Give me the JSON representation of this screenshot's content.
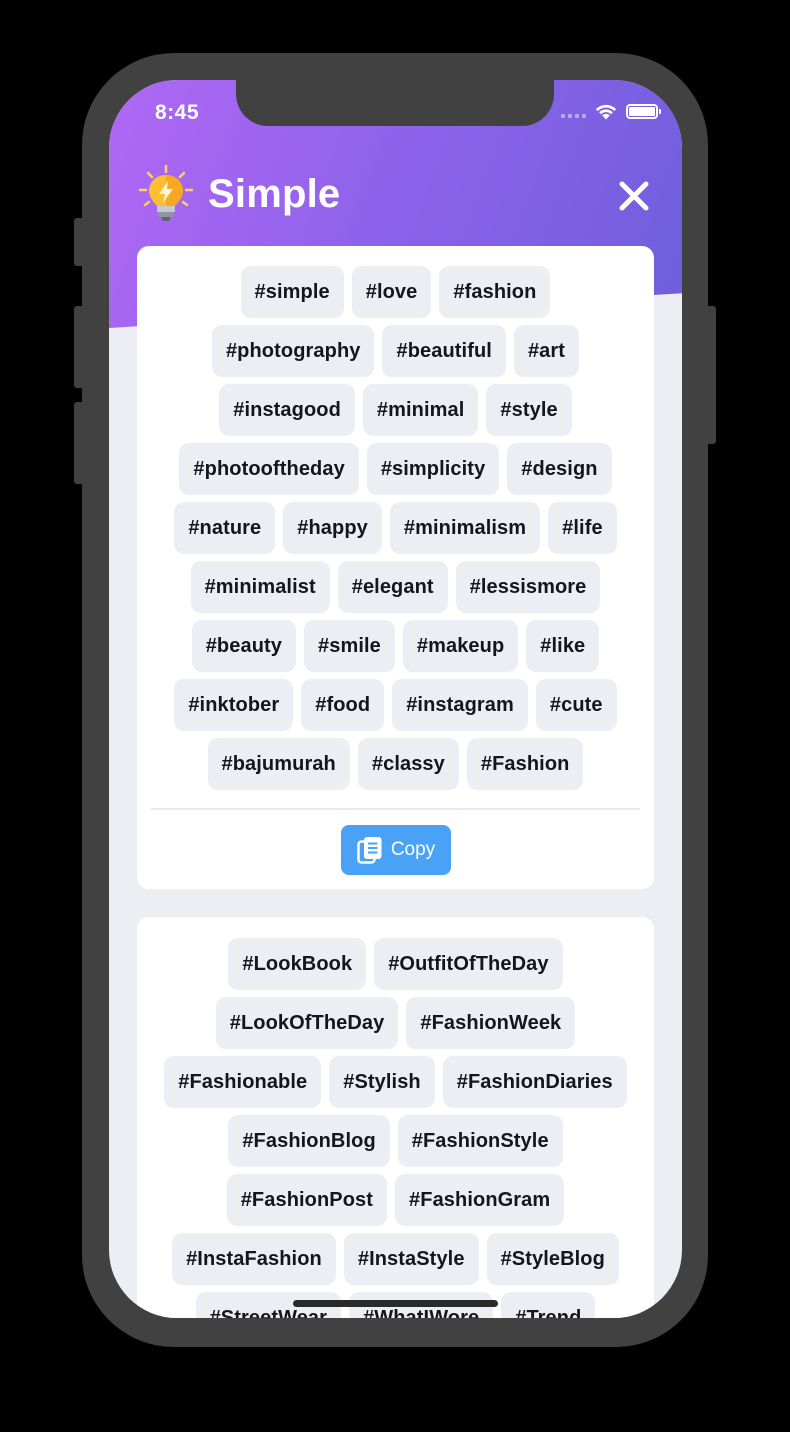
{
  "status_bar": {
    "time": "8:45"
  },
  "header": {
    "title": "Simple"
  },
  "card1": {
    "tags": [
      "#simple",
      "#love",
      "#fashion",
      "#photography",
      "#beautiful",
      "#art",
      "#instagood",
      "#minimal",
      "#style",
      "#photooftheday",
      "#simplicity",
      "#design",
      "#nature",
      "#happy",
      "#minimalism",
      "#life",
      "#minimalist",
      "#elegant",
      "#lessismore",
      "#beauty",
      "#smile",
      "#makeup",
      "#like",
      "#inktober",
      "#food",
      "#instagram",
      "#cute",
      "#bajumurah",
      "#classy",
      "#Fashion"
    ],
    "copy_label": "Copy"
  },
  "card2": {
    "tags": [
      "#LookBook",
      "#OutfitOfTheDay",
      "#LookOfTheDay",
      "#FashionWeek",
      "#Fashionable",
      "#Stylish",
      "#FashionDiaries",
      "#FashionBlog",
      "#FashionStyle",
      "#FashionPost",
      "#FashionGram",
      "#InstaFashion",
      "#InstaStyle",
      "#StyleBlog",
      "#StreetWear",
      "#WhatIWore",
      "#Trend"
    ]
  },
  "colors": {
    "header_start": "#b068f5",
    "header_end": "#6e5fdc",
    "copy_button": "#4aa2f7",
    "tag_bg": "#eceef3"
  },
  "icons": {
    "logo": "lightbulb-icon",
    "close": "close-icon",
    "copy": "copy-icon"
  }
}
